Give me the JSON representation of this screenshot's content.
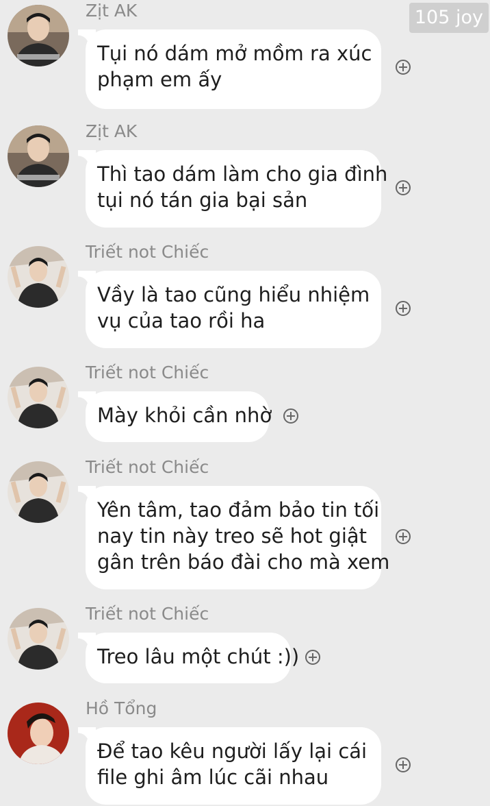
{
  "watermark": "105 joy",
  "messages": [
    {
      "sender": "Zịt AK",
      "avatar": "avatar-ak-icon",
      "lines": [
        "Tụi nó dám mở mồm ra xúc",
        "phạm em ấy"
      ]
    },
    {
      "sender": "Zịt AK",
      "avatar": "avatar-ak-icon",
      "lines": [
        "Thì tao dám làm cho gia đình",
        "tụi nó tán gia bại sản"
      ]
    },
    {
      "sender": "Triết not Chiếc",
      "avatar": "avatar-triet-icon",
      "lines": [
        "Vầy là tao cũng hiểu nhiệm",
        "vụ của tao rồi ha"
      ]
    },
    {
      "sender": "Triết not Chiếc",
      "avatar": "avatar-triet-icon",
      "lines": [
        "Mày khỏi cần nhờ"
      ]
    },
    {
      "sender": "Triết not Chiếc",
      "avatar": "avatar-triet-icon",
      "lines": [
        "Yên tâm, tao đảm bảo tin tối",
        "nay tin này treo sẽ hot giật",
        "gân trên báo đài cho mà xem"
      ]
    },
    {
      "sender": "Triết not Chiếc",
      "avatar": "avatar-triet-icon",
      "lines": [
        "Treo lâu một chút :))"
      ]
    },
    {
      "sender": "Hồ Tổng",
      "avatar": "avatar-ho-icon",
      "lines": [
        "Để tao kêu người lấy lại cái",
        "file ghi âm lúc cãi nhau"
      ]
    }
  ]
}
